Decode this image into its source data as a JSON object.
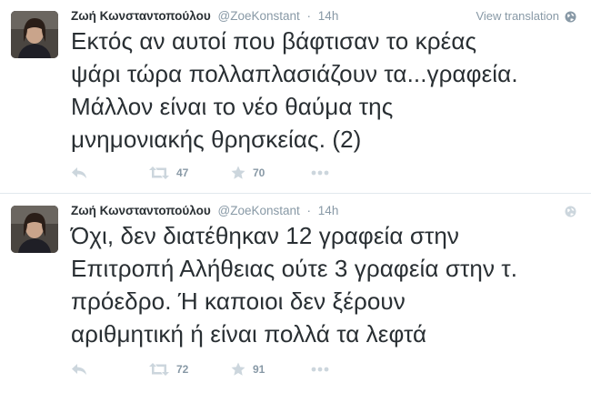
{
  "tweets": [
    {
      "fullname": "Ζωή Κωνσταντοπούλου",
      "username": "@ZoeKonstant",
      "separator": "·",
      "time": "14h",
      "view_translation": "View translation",
      "text_lines": [
        "Εκτός αν αυτοί που βάφτισαν το κρέας",
        "ψάρι τώρα πολλαπλασιάζουν τα...γραφεία.",
        "Μάλλον είναι το νέο θαύμα της",
        "μνημονιακής θρησκείας. (2)"
      ],
      "retweets": "47",
      "favorites": "70"
    },
    {
      "fullname": "Ζωή Κωνσταντοπούλου",
      "username": "@ZoeKonstant",
      "separator": "·",
      "time": "14h",
      "text_lines": [
        "Όχι, δεν διατέθηκαν 12 γραφεία στην",
        "Επιτροπή Αλήθειας ούτε 3 γραφεία στην τ.",
        "πρόεδρο. Ή καποιοι δεν ξέρουν",
        "αριθμητική ή είναι πολλά τα λεφτά"
      ],
      "retweets": "72",
      "favorites": "91"
    }
  ],
  "icons": {
    "reply": "reply-icon",
    "retweet": "retweet-icon",
    "favorite": "star-icon",
    "more": "more-icon",
    "globe": "globe-icon"
  },
  "colors": {
    "text": "#292f33",
    "muted": "#8899a6",
    "icon": "#ccd6dd",
    "divider": "#e1e8ed"
  }
}
